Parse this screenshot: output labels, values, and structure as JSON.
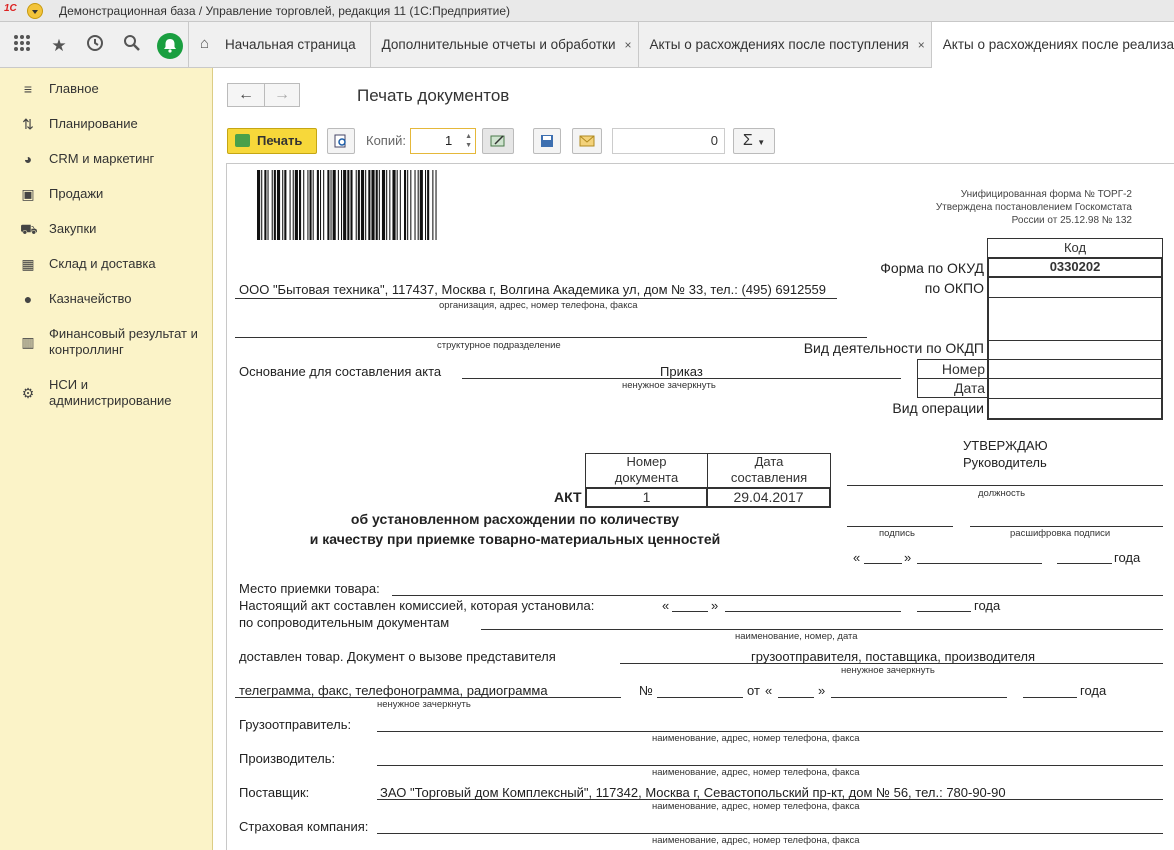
{
  "window": {
    "title": "Демонстрационная база / Управление торговлей, редакция 11  (1С:Предприятие)",
    "logo": "1С"
  },
  "topbar": {
    "icons": [
      "apps-icon",
      "star-icon",
      "history-icon",
      "search-icon",
      "bell-icon"
    ]
  },
  "tabs": [
    {
      "label": "Начальная страница"
    },
    {
      "label": "Дополнительные отчеты и обработки"
    },
    {
      "label": "Акты о расхождениях после поступления"
    },
    {
      "label": "Акты о расхождениях после реализации"
    }
  ],
  "close_glyph": "×",
  "sidebar": {
    "items": [
      {
        "label": "Главное",
        "icon": "menu-icon"
      },
      {
        "label": "Планирование",
        "icon": "planning-icon"
      },
      {
        "label": "CRM и маркетинг",
        "icon": "crm-icon"
      },
      {
        "label": "Продажи",
        "icon": "sales-icon"
      },
      {
        "label": "Закупки",
        "icon": "cart-icon"
      },
      {
        "label": "Склад и доставка",
        "icon": "warehouse-icon"
      },
      {
        "label": "Казначейство",
        "icon": "treasury-icon"
      },
      {
        "label": "Финансовый результат и контроллинг",
        "icon": "chart-icon"
      },
      {
        "label": "НСИ и администрирование",
        "icon": "gear-icon"
      }
    ]
  },
  "page": {
    "title": "Печать документов",
    "print_label": "Печать",
    "copies_label": "Копий:",
    "copies_value": "1",
    "sum_value": "0",
    "sum_glyph": "Σ"
  },
  "doc": {
    "form_header": [
      "Унифицированная форма № ТОРГ-2",
      "Утверждена постановлением Госкомстата",
      "России от 25.12.98 № 132"
    ],
    "code_header": "Код",
    "okud_label": "Форма по ОКУД",
    "okud_value": "0330202",
    "okpo_label": "по ОКПО",
    "okdp_label": "Вид деятельности по ОКДП",
    "number_label": "Номер",
    "date_label": "Дата",
    "operation_label": "Вид операции",
    "org": "ООО \"Бытовая техника\", 117437, Москва г, Волгина Академика ул, дом № 33, тел.: (495) 6912559",
    "org_caption": "организация, адрес, номер телефона, факса",
    "dept_caption": "структурное подразделение",
    "basis_label": "Основание для составления акта",
    "basis_value": "Приказ",
    "strike_caption": "ненужное зачеркнуть",
    "approve": "УТВЕРЖДАЮ",
    "head": "Руководитель",
    "position_caption": "должность",
    "signature_caption": "подпись",
    "decode_caption": "расшифровка подписи",
    "quote_open": "«",
    "quote_close": "»",
    "year": "года",
    "doc_number_header": "Номер документа",
    "doc_date_header": "Дата составления",
    "act_label": "АКТ",
    "act_number": "1",
    "act_date": "29.04.2017",
    "act_title_1": "об установленном расхождении по количеству",
    "act_title_2": "и качеству при приемке товарно-материальных ценностей",
    "place_label": "Место приемки товара:",
    "commission_label": "Настоящий акт составлен комиссией, которая установила:",
    "accomp_label": "по сопроводительным документам",
    "name_number_date_caption": "наименование, номер, дата",
    "delivered_label": "доставлен товар. Документ о вызове представителя",
    "delivered_value": "грузоотправителя, поставщика, производителя",
    "telegram_label": "телеграмма, факс, телефонограмма, радиограмма",
    "number_sign": "№",
    "from_label": "от",
    "shipper_label": "Грузоотправитель:",
    "name_addr_caption": "наименование, адрес, номер телефона, факса",
    "producer_label": "Производитель:",
    "supplier_label": "Поставщик:",
    "supplier_value": "ЗАО \"Торговый дом Комплексный\", 117342, Москва г, Севастопольский пр-кт, дом № 56, тел.: 780-90-90",
    "insurance_label": "Страховая компания:"
  },
  "colors": {
    "sidebar_bg": "#fbf3c8",
    "print_button": "#f7d83a",
    "bell": "#1a9f40",
    "accent_border": "#e5b83a"
  }
}
